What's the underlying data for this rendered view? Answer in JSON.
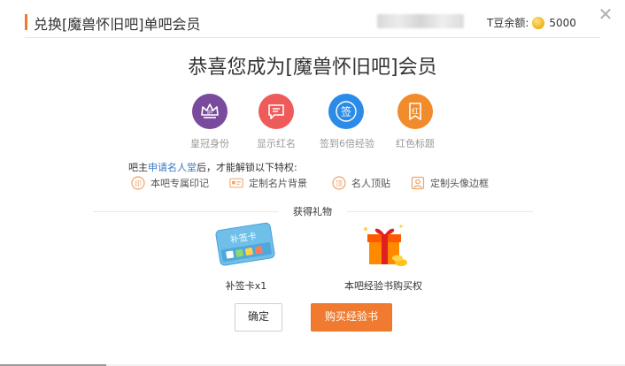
{
  "header": {
    "title": "兑换[魔兽怀旧吧]单吧会员",
    "balance_label": "T豆余额:",
    "balance_value": "5000"
  },
  "headline": "恭喜您成为[魔兽怀旧吧]会员",
  "privileges": [
    {
      "label": "皇冠身份",
      "icon": "crown-icon",
      "color": "#7a4a9c"
    },
    {
      "label": "显示红名",
      "icon": "chat-bubble-icon",
      "color": "#ef5a5a"
    },
    {
      "label": "签到6倍经验",
      "icon": "sign-in-icon",
      "color": "#2c8be6"
    },
    {
      "label": "红色标题",
      "icon": "red-title-icon",
      "color": "#f28b2b"
    }
  ],
  "unlock": {
    "prefix": "吧主",
    "link": "申请名人堂",
    "suffix": "后，才能解锁以下特权:",
    "items": [
      {
        "label": "本吧专属印记",
        "icon": "seal-icon"
      },
      {
        "label": "定制名片背景",
        "icon": "card-icon"
      },
      {
        "label": "名人顶贴",
        "icon": "top-post-icon"
      },
      {
        "label": "定制头像边框",
        "icon": "avatar-frame-icon"
      }
    ]
  },
  "gifts": {
    "title": "获得礼物",
    "items": [
      {
        "label": "补签卡x1",
        "card_text": "补签卡"
      },
      {
        "label": "本吧经验书购买权"
      }
    ]
  },
  "buttons": {
    "ok": "确定",
    "buy": "购买经验书"
  },
  "colors": {
    "accent": "#f07a2f",
    "link": "#3a77c6"
  }
}
